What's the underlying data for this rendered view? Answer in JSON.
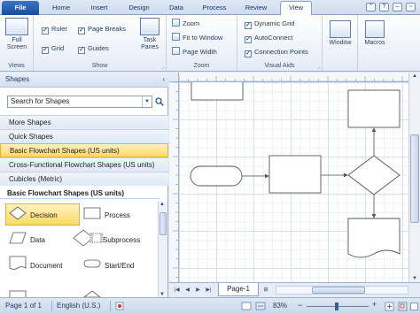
{
  "tabs": [
    {
      "id": "file",
      "label": "File"
    },
    {
      "id": "home",
      "label": "Home"
    },
    {
      "id": "insert",
      "label": "Insert"
    },
    {
      "id": "design",
      "label": "Design"
    },
    {
      "id": "data",
      "label": "Data"
    },
    {
      "id": "process",
      "label": "Process"
    },
    {
      "id": "review",
      "label": "Review"
    },
    {
      "id": "view",
      "label": "View"
    }
  ],
  "ribbon": {
    "views": {
      "label": "Views",
      "full_screen": "Full Screen"
    },
    "show": {
      "label": "Show",
      "ruler": "Ruler",
      "grid": "Grid",
      "page_breaks": "Page Breaks",
      "guides": "Guides",
      "task_panes": "Task Panes"
    },
    "zoom": {
      "label": "Zoom",
      "zoom": "Zoom",
      "fit_to_window": "Fit to Window",
      "page_width": "Page Width"
    },
    "visual_aids": {
      "label": "Visual Aids",
      "dynamic_grid": "Dynamic Grid",
      "autoconnect": "AutoConnect",
      "connection_points": "Connection Points"
    },
    "window": {
      "label": "Window"
    },
    "macros": {
      "label": "Macros"
    }
  },
  "shapes_pane": {
    "title": "Shapes",
    "search_placeholder": "Search for Shapes",
    "more_shapes": "More Shapes",
    "quick_shapes": "Quick Shapes",
    "stencils": [
      {
        "label": "Basic Flowchart Shapes (US units)",
        "active": true
      },
      {
        "label": "Cross-Functional Flowchart Shapes (US units)",
        "active": false
      },
      {
        "label": "Cubicles (Metric)",
        "active": false
      }
    ],
    "stencil_title": "Basic Flowchart Shapes (US units)",
    "masters": [
      "Decision",
      "Process",
      "Data",
      "Subprocess",
      "Document",
      "Start/End"
    ]
  },
  "page_tab": "Page-1",
  "status": {
    "page": "Page 1 of 1",
    "language": "English (U.S.)",
    "zoom": "83%"
  },
  "colors": {
    "file_tab": "#1a4c9b",
    "highlight": "#ffd966",
    "canvas_grid": "#d7dfe9"
  }
}
